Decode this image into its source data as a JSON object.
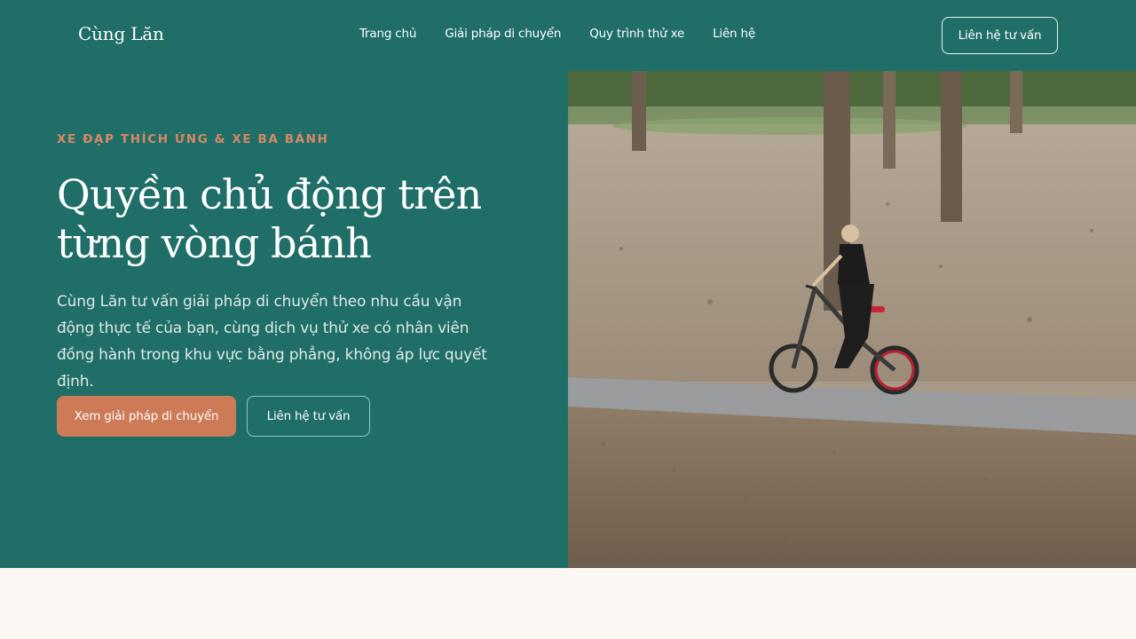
{
  "header": {
    "logo": "Cùng Lăn",
    "nav": [
      {
        "label": "Trang chủ"
      },
      {
        "label": "Giải pháp di chuyển"
      },
      {
        "label": "Quy trình thử xe"
      },
      {
        "label": "Liên hệ"
      }
    ],
    "cta": "Liên hệ tư vấn"
  },
  "hero": {
    "eyebrow": "XE ĐẠP THÍCH ỨNG & XE BA BÁNH",
    "title_line1": "Quyền chủ động trên",
    "title_line2": "từng vòng bánh",
    "description": "Cùng Lăn tư vấn giải pháp di chuyển theo nhu cầu vận động thực tế của bạn, cùng dịch vụ thử xe có nhân viên đồng hành trong khu vực bằng phẳng, không áp lực quyết định.",
    "primary_button": "Xem giải pháp di chuyển",
    "secondary_button": "Liên hệ tư vấn",
    "image": "person-riding-adaptive-bike-in-park"
  },
  "colors": {
    "brand_green": "#1f6e67",
    "accent_orange": "#cd7a56",
    "page_bg": "#fbf7f2"
  }
}
